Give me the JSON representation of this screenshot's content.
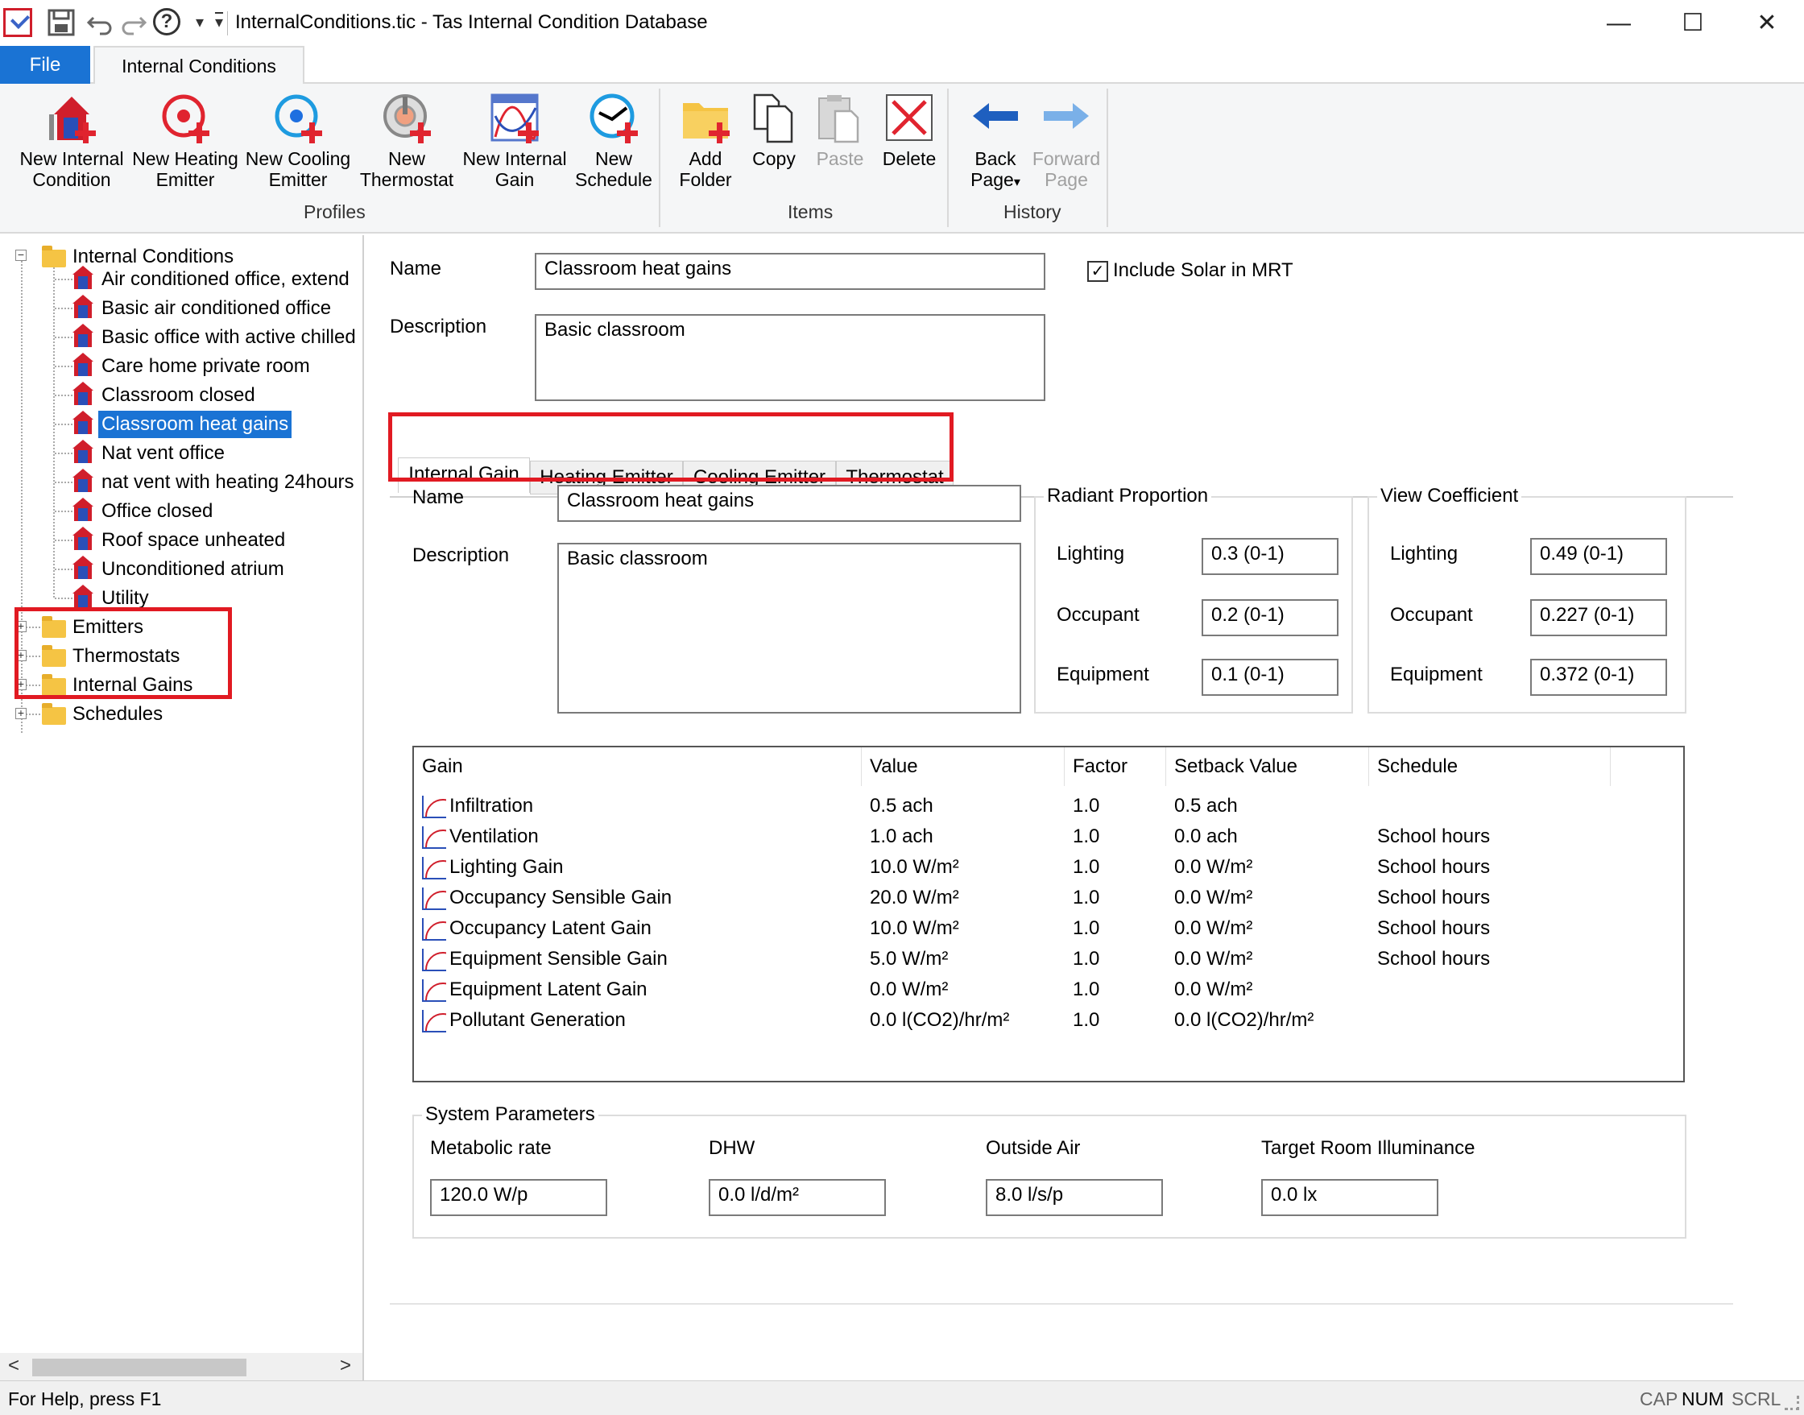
{
  "window": {
    "title": "InternalConditions.tic - Tas Internal Condition Database",
    "minimize_glyph": "—",
    "maximize_glyph": "☐",
    "close_glyph": "✕"
  },
  "quick_access": {
    "save_icon": "save-icon",
    "undo_icon": "undo-icon",
    "redo_icon": "redo-icon",
    "help_icon": "help-icon",
    "help_glyph": "?",
    "dropdown_glyph": "▾",
    "customize_glyph": "▾"
  },
  "ribbon": {
    "file_tab": "File",
    "active_tab": "Internal Conditions",
    "profiles": {
      "group_label": "Profiles",
      "new_internal_condition": [
        "New Internal",
        "Condition"
      ],
      "new_heating_emitter": [
        "New Heating",
        "Emitter"
      ],
      "new_cooling_emitter": [
        "New Cooling",
        "Emitter"
      ],
      "new_thermostat": [
        "New",
        "Thermostat"
      ],
      "new_internal_gain": [
        "New Internal",
        "Gain"
      ],
      "new_schedule": [
        "New",
        "Schedule"
      ]
    },
    "items": {
      "group_label": "Items",
      "add_folder": [
        "Add",
        "Folder"
      ],
      "copy": "Copy",
      "paste": "Paste",
      "delete": "Delete"
    },
    "history": {
      "group_label": "History",
      "back_page": [
        "Back",
        "Page"
      ],
      "back_dropdown_glyph": "▾",
      "forward_page": [
        "Forward",
        "Page"
      ]
    }
  },
  "tree": {
    "root": "Internal Conditions",
    "children": [
      "Air conditioned office, extend",
      "Basic air conditioned office",
      "Basic office with active chilled",
      "Care home private room",
      "Classroom closed",
      "Classroom heat gains",
      "Nat vent office",
      "nat vent with heating 24hours",
      "Office closed",
      "Roof space unheated",
      "Unconditioned atrium",
      "Utility"
    ],
    "selected_index": 5,
    "folders": [
      "Emitters",
      "Thermostats",
      "Internal Gains",
      "Schedules"
    ],
    "collapse_glyph": "−",
    "expand_glyph": "+",
    "scroll_left_glyph": "<",
    "scroll_right_glyph": ">"
  },
  "condition": {
    "name_label": "Name",
    "name_value": "Classroom heat gains",
    "description_label": "Description",
    "description_value": "Basic classroom",
    "include_solar_label": "Include Solar in MRT",
    "include_solar_checked": true,
    "check_glyph": "✓"
  },
  "tabs": [
    "Internal Gain",
    "Heating Emitter",
    "Cooling Emitter",
    "Thermostat"
  ],
  "internal_gain": {
    "name_label": "Name",
    "name_value": "Classroom heat gains",
    "description_label": "Description",
    "description_value": "Basic classroom",
    "radiant_proportion": {
      "title": "Radiant Proportion",
      "lighting_label": "Lighting",
      "lighting_value": "0.3 (0-1)",
      "occupant_label": "Occupant",
      "occupant_value": "0.2 (0-1)",
      "equipment_label": "Equipment",
      "equipment_value": "0.1 (0-1)"
    },
    "view_coefficient": {
      "title": "View Coefficient",
      "lighting_label": "Lighting",
      "lighting_value": "0.49 (0-1)",
      "occupant_label": "Occupant",
      "occupant_value": "0.227 (0-1)",
      "equipment_label": "Equipment",
      "equipment_value": "0.372 (0-1)"
    },
    "table": {
      "headers": [
        "Gain",
        "Value",
        "Factor",
        "Setback Value",
        "Schedule"
      ],
      "rows": [
        {
          "gain": "Infiltration",
          "value": "0.5 ach",
          "factor": "1.0",
          "setback": "0.5 ach",
          "schedule": ""
        },
        {
          "gain": "Ventilation",
          "value": "1.0 ach",
          "factor": "1.0",
          "setback": "0.0 ach",
          "schedule": "School hours"
        },
        {
          "gain": "Lighting Gain",
          "value": "10.0 W/m²",
          "factor": "1.0",
          "setback": "0.0 W/m²",
          "schedule": "School hours"
        },
        {
          "gain": "Occupancy Sensible Gain",
          "value": "20.0 W/m²",
          "factor": "1.0",
          "setback": "0.0 W/m²",
          "schedule": "School hours"
        },
        {
          "gain": "Occupancy Latent Gain",
          "value": "10.0 W/m²",
          "factor": "1.0",
          "setback": "0.0 W/m²",
          "schedule": "School hours"
        },
        {
          "gain": "Equipment Sensible Gain",
          "value": "5.0 W/m²",
          "factor": "1.0",
          "setback": "0.0 W/m²",
          "schedule": "School hours"
        },
        {
          "gain": "Equipment Latent Gain",
          "value": "0.0 W/m²",
          "factor": "1.0",
          "setback": "0.0 W/m²",
          "schedule": ""
        },
        {
          "gain": "Pollutant Generation",
          "value": "0.0 l(CO2)/hr/m²",
          "factor": "1.0",
          "setback": "0.0 l(CO2)/hr/m²",
          "schedule": ""
        }
      ]
    },
    "system_parameters": {
      "title": "System Parameters",
      "metabolic_rate_label": "Metabolic rate",
      "metabolic_rate_value": "120.0 W/p",
      "dhw_label": "DHW",
      "dhw_value": "0.0 l/d/m²",
      "outside_air_label": "Outside Air",
      "outside_air_value": "8.0 l/s/p",
      "illuminance_label": "Target Room Illuminance",
      "illuminance_value": "0.0 lx"
    }
  },
  "status": {
    "help": "For Help, press F1",
    "cap": "CAP",
    "num": "NUM",
    "scrl": "SCRL"
  },
  "colors": {
    "accent": "#1a73d4",
    "highlight_box": "#e11a22",
    "icon_red": "#d01e2b",
    "icon_blue": "#2a4fb8"
  }
}
